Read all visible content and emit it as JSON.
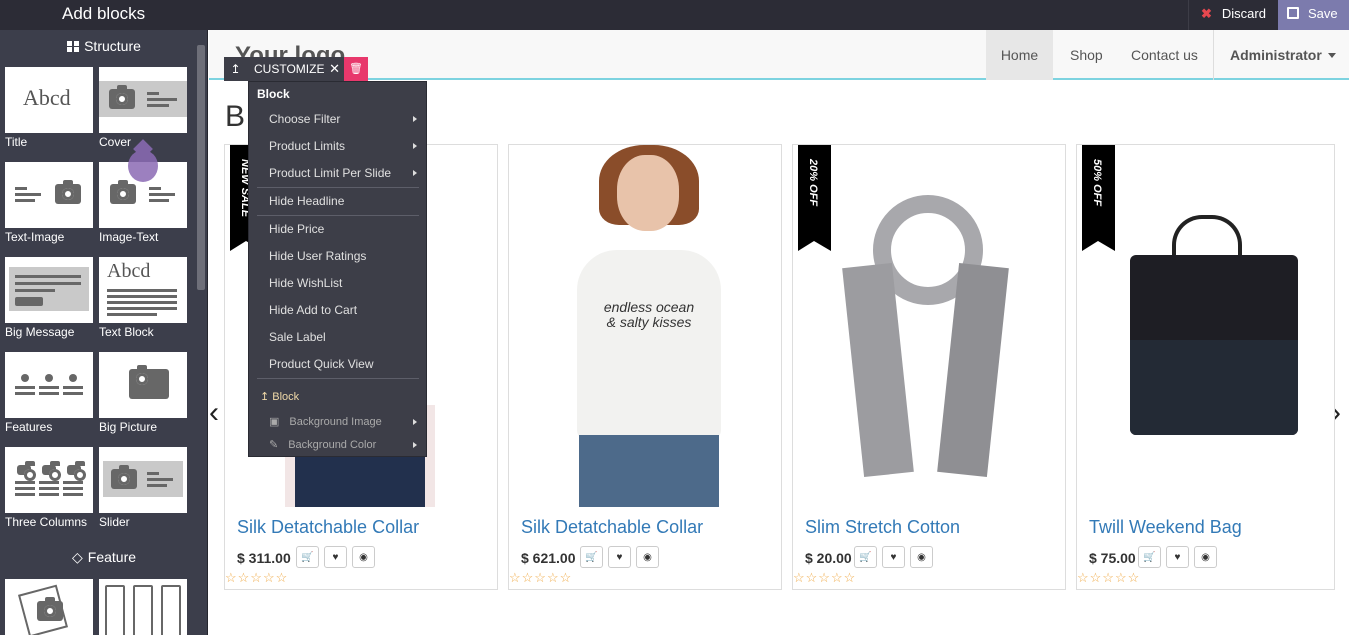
{
  "topbar": {
    "title": "Add blocks",
    "discard_label": "Discard",
    "save_label": "Save"
  },
  "sidebar": {
    "structure_heading": "Structure",
    "feature_heading": "Feature",
    "blocks": [
      "Title",
      "Cover",
      "Text-Image",
      "Image-Text",
      "Big Message",
      "Text Block",
      "Features",
      "Big Picture",
      "Three Columns",
      "Slider"
    ],
    "title_thumb_text": "Abcd",
    "textblock_thumb_text": "Abcd"
  },
  "site": {
    "logo": "Your logo",
    "nav": [
      "Home",
      "Shop",
      "Contact us"
    ],
    "user": "Administrator",
    "snippet_title_initial": "B"
  },
  "overlay": {
    "handle": "↥",
    "customize_label": "CUSTOMIZE",
    "close": "✕",
    "menu": {
      "header": "Block",
      "items": [
        "Choose Filter",
        "Product Limits",
        "Product Limit Per Slide",
        "Hide Headline",
        "Hide Price",
        "Hide User Ratings",
        "Hide WishList",
        "Hide Add to Cart",
        "Sale Label",
        "Product Quick View"
      ],
      "sub_header": "Block",
      "sub_items": [
        "Background Image",
        "Background Color"
      ]
    }
  },
  "products": [
    {
      "name": "Silk Detatchable Collar",
      "price": "$ 311.00",
      "ribbon": "NEW SALE"
    },
    {
      "name": "Silk Detatchable Collar",
      "price": "$ 621.00",
      "ribbon": ""
    },
    {
      "name": "Slim Stretch Cotton",
      "price": "$ 20.00",
      "ribbon": "20% OFF"
    },
    {
      "name": "Twill Weekend Bag",
      "price": "$ 75.00",
      "ribbon": "50% OFF"
    }
  ],
  "shirt_text": "endless ocean & salty kisses",
  "stars": "☆☆☆☆☆",
  "colors": {
    "accent": "#7c7bad",
    "delete": "#e8386c",
    "sidebar": "#3c3e4b",
    "link": "#337ab7",
    "stars": "#f0ad4e"
  }
}
